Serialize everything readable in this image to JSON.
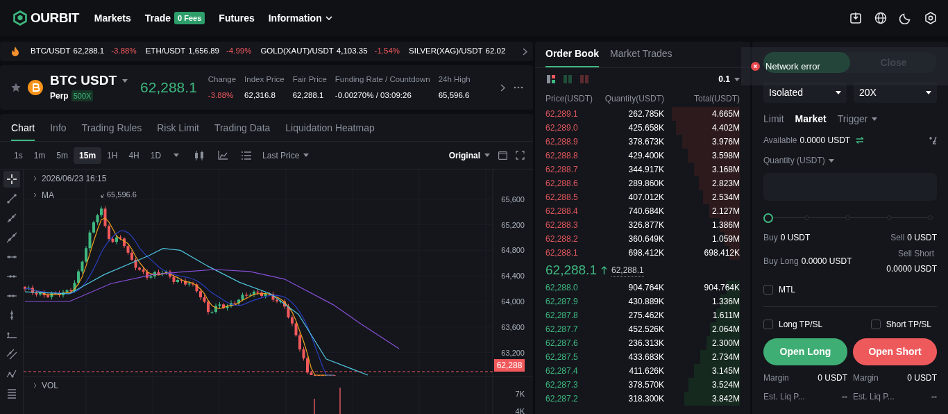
{
  "header": {
    "logo": "OURBIT",
    "nav": [
      {
        "label": "Markets"
      },
      {
        "label": "Trade",
        "badge": "0 Fees"
      },
      {
        "label": "Futures"
      },
      {
        "label": "Information",
        "dropdown": true
      }
    ]
  },
  "ticker": [
    {
      "pair": "BTC/USDT",
      "price": "62,288.1",
      "change": "-3.88%",
      "down": true
    },
    {
      "pair": "ETH/USDT",
      "price": "1,656.89",
      "change": "-4.99%",
      "down": true
    },
    {
      "pair": "GOLD(XAUT)/USDT",
      "price": "4,103.35",
      "change": "-1.54%",
      "down": true
    },
    {
      "pair": "SILVER(XAG)/USDT",
      "price": "62.02"
    }
  ],
  "symbol": {
    "name": "BTC USDT",
    "type": "Perp",
    "leverage": "500X",
    "price": "62,288.1",
    "stats": [
      {
        "label": "Change",
        "value": "-3.88%",
        "down": true
      },
      {
        "label": "Index Price",
        "value": "62,316.8"
      },
      {
        "label": "Fair Price",
        "value": "62,288.1"
      },
      {
        "label": "Funding Rate / Countdown",
        "value": "-0.00270% / 03:09:26"
      },
      {
        "label": "24h High",
        "value": "65,596.6"
      }
    ]
  },
  "chart_tabs": [
    {
      "label": "Chart",
      "selected": true
    },
    {
      "label": "Info",
      "selected": false
    },
    {
      "label": "Trading Rules",
      "selected": false
    },
    {
      "label": "Risk Limit",
      "selected": false
    },
    {
      "label": "Trading Data",
      "selected": false
    },
    {
      "label": "Liquidation Heatmap",
      "selected": false
    }
  ],
  "intervals": [
    {
      "label": "1s",
      "selected": false
    },
    {
      "label": "1m",
      "selected": false
    },
    {
      "label": "5m",
      "selected": false
    },
    {
      "label": "15m",
      "selected": true
    },
    {
      "label": "1H",
      "selected": false
    },
    {
      "label": "4H",
      "selected": false
    },
    {
      "label": "1D",
      "selected": false
    }
  ],
  "price_type": "Last Price",
  "view": "Original",
  "chart": {
    "time": "2026/06/23 16:15",
    "ma_label": "MA",
    "peak": "65,596.6",
    "price_axis": [
      "65,600",
      "65,200",
      "64,800",
      "64,400",
      "64,000",
      "63,600",
      "63,200"
    ],
    "last_price": "62,288",
    "volume_label": "VOL",
    "volume_axis": [
      "7K",
      "4K"
    ]
  },
  "order_book": {
    "tabs": [
      {
        "label": "Order Book",
        "selected": true
      },
      {
        "label": "Market Trades",
        "selected": false
      }
    ],
    "precision": "0.1",
    "columns": [
      "Price(USDT)",
      "Quantity(USDT)",
      "Total(USDT)"
    ],
    "asks": [
      {
        "price": "62,289.1",
        "quantity": "262.785K",
        "total": "4.665M"
      },
      {
        "price": "62,289.0",
        "quantity": "425.658K",
        "total": "4.402M"
      },
      {
        "price": "62,288.9",
        "quantity": "378.673K",
        "total": "3.976M"
      },
      {
        "price": "62,288.8",
        "quantity": "429.400K",
        "total": "3.598M"
      },
      {
        "price": "62,288.7",
        "quantity": "344.917K",
        "total": "3.168M"
      },
      {
        "price": "62,288.6",
        "quantity": "289.860K",
        "total": "2.823M"
      },
      {
        "price": "62,288.5",
        "quantity": "407.012K",
        "total": "2.534M"
      },
      {
        "price": "62,288.4",
        "quantity": "740.684K",
        "total": "2.127M"
      },
      {
        "price": "62,288.3",
        "quantity": "326.877K",
        "total": "1.386M"
      },
      {
        "price": "62,288.2",
        "quantity": "360.649K",
        "total": "1.059M"
      },
      {
        "price": "62,288.1",
        "quantity": "698.412K",
        "total": "698.412K"
      }
    ],
    "last_price": "62,288.1",
    "mark_price": "62,288.1",
    "bids": [
      {
        "price": "62,288.0",
        "quantity": "904.764K",
        "total": "904.764K"
      },
      {
        "price": "62,287.9",
        "quantity": "430.889K",
        "total": "1.336M"
      },
      {
        "price": "62,287.8",
        "quantity": "275.462K",
        "total": "1.611M"
      },
      {
        "price": "62,287.7",
        "quantity": "452.526K",
        "total": "2.064M"
      },
      {
        "price": "62,287.6",
        "quantity": "236.313K",
        "total": "2.300M"
      },
      {
        "price": "62,287.5",
        "quantity": "433.683K",
        "total": "2.734M"
      },
      {
        "price": "62,287.4",
        "quantity": "411.626K",
        "total": "3.145M"
      },
      {
        "price": "62,287.3",
        "quantity": "378.570K",
        "total": "3.524M"
      },
      {
        "price": "62,287.2",
        "quantity": "318.300K",
        "total": "3.842M"
      }
    ]
  },
  "trade_panel": {
    "sides": [
      {
        "selected": true
      },
      {
        "label": "Close",
        "selected": false
      }
    ],
    "margin_mode": "Isolated",
    "leverage": "20X",
    "order_types": [
      {
        "label": "Limit",
        "selected": false
      },
      {
        "label": "Market",
        "selected": true
      },
      {
        "label": "Trigger",
        "selected": false,
        "dropdown": true
      }
    ],
    "available_label": "Available",
    "available": "0.0000 USDT",
    "quantity_label": "Quantity (USDT)",
    "slider": {
      "level": 0
    },
    "buy_label": "Buy",
    "buy": "0 USDT",
    "sell_label": "Sell",
    "sell": "0 USDT",
    "buy_long_label": "Buy Long",
    "buy_long": "0.0000 USDT",
    "sell_short_label": "Sell Short",
    "sell_short": "0.0000 USDT",
    "options": [
      {
        "label": "MTL",
        "checked": false
      }
    ],
    "tpsl": [
      {
        "label": "Long TP/SL",
        "checked": false
      },
      {
        "label": "Short TP/SL",
        "checked": false
      }
    ],
    "buttons": [
      {
        "label": "Open Long",
        "kind": "long"
      },
      {
        "label": "Open Short",
        "kind": "short"
      }
    ],
    "summary": [
      {
        "items": [
          {
            "label": "Margin",
            "value": "0 USDT"
          },
          {
            "label": "Est. Liq P...",
            "value": "--"
          }
        ]
      },
      {
        "items": [
          {
            "label": "Margin",
            "value": "0 USDT"
          },
          {
            "label": "Est. Liq P...",
            "value": "--"
          }
        ]
      }
    ]
  },
  "toast": {
    "message": "Network error"
  }
}
